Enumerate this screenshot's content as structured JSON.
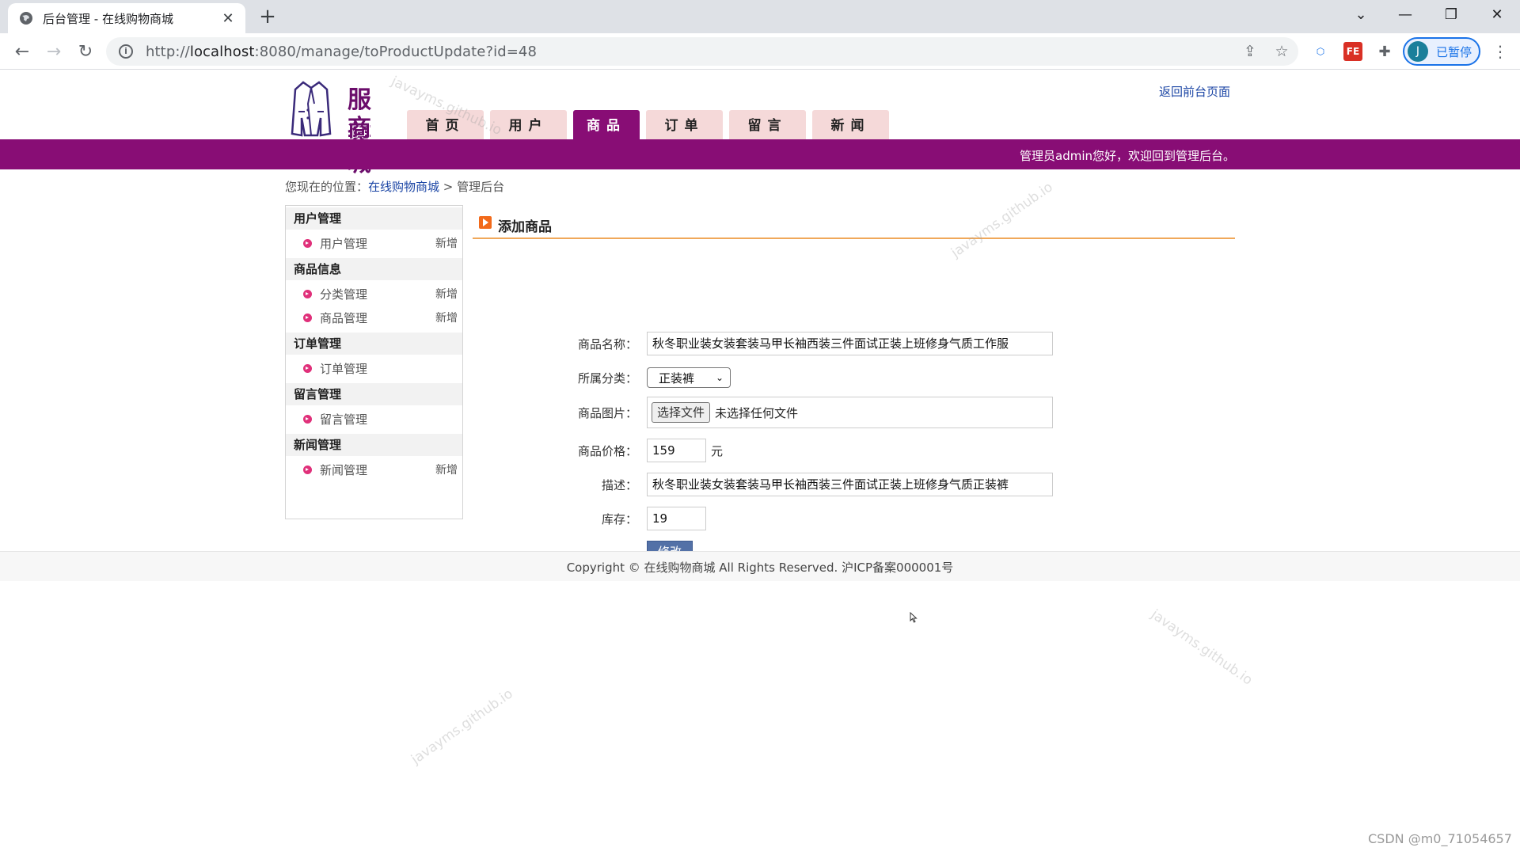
{
  "browser": {
    "tab_title": "后台管理 - 在线购物商城",
    "url_prefix": "http://",
    "url_host": "localhost",
    "url_rest": ":8080/manage/toProductUpdate?id=48",
    "profile_initial": "J",
    "profile_label": "已暂停"
  },
  "site": {
    "logo_line1": "服装",
    "logo_line2": "商城",
    "nav": [
      "首页",
      "用户",
      "商品",
      "订单",
      "留言",
      "新闻"
    ],
    "active_nav": "商品",
    "back_link": "返回前台页面",
    "welcome": "管理员admin您好，欢迎回到管理后台。"
  },
  "breadcrumb": {
    "prefix": "您现在的位置：",
    "link": "在线购物商城",
    "sep": " > ",
    "current": "管理后台"
  },
  "sidebar": {
    "groups": [
      {
        "title": "用户管理",
        "items": [
          {
            "label": "用户管理",
            "add": "新增"
          }
        ]
      },
      {
        "title": "商品信息",
        "items": [
          {
            "label": "分类管理",
            "add": "新增"
          },
          {
            "label": "商品管理",
            "add": "新增"
          }
        ]
      },
      {
        "title": "订单管理",
        "items": [
          {
            "label": "订单管理",
            "add": ""
          }
        ]
      },
      {
        "title": "留言管理",
        "items": [
          {
            "label": "留言管理",
            "add": ""
          }
        ]
      },
      {
        "title": "新闻管理",
        "items": [
          {
            "label": "新闻管理",
            "add": "新增"
          }
        ]
      }
    ]
  },
  "content": {
    "title": "添加商品",
    "form": {
      "name_label": "商品名称：",
      "name_value": "秋冬职业装女装套装马甲长袖西装三件面试正装上班修身气质工作服",
      "category_label": "所属分类：",
      "category_value": "正装裤",
      "image_label": "商品图片：",
      "file_button": "选择文件",
      "file_status": "未选择任何文件",
      "price_label": "商品价格：",
      "price_value": "159",
      "price_unit": "元",
      "desc_label": "描述：",
      "desc_value": "秋冬职业装女装套装马甲长袖西装三件面试正装上班修身气质正装裤",
      "stock_label": "库存：",
      "stock_value": "19",
      "submit_label": "修改"
    }
  },
  "footer": {
    "text": "Copyright © 在线购物商城 All Rights Reserved. 沪ICP备案000001号"
  },
  "watermark": "javayms.github.io",
  "attribution": "CSDN @m0_71054657"
}
